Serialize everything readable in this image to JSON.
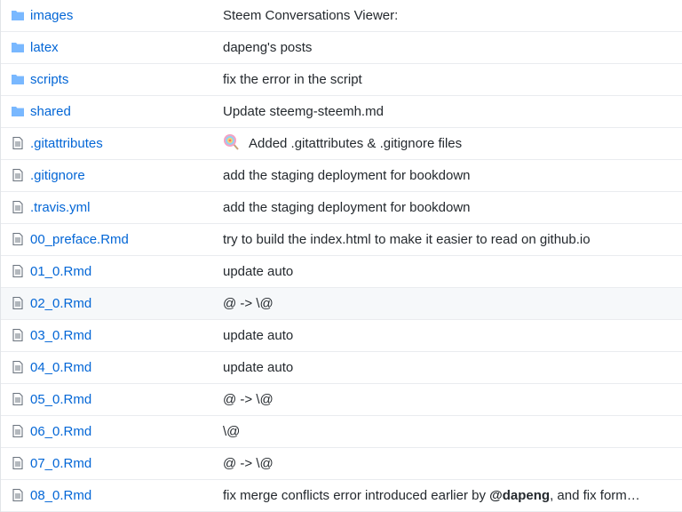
{
  "files": [
    {
      "name": "images",
      "type": "folder",
      "message": "Steem Conversations Viewer:"
    },
    {
      "name": "latex",
      "type": "folder",
      "message": "dapeng's posts"
    },
    {
      "name": "scripts",
      "type": "folder",
      "message": "fix the error in the script"
    },
    {
      "name": "shared",
      "type": "folder",
      "message": "Update steemg-steemh.md"
    },
    {
      "name": ".gitattributes",
      "type": "file",
      "message": "Added .gitattributes & .gitignore files",
      "message_icon": "lollipop-icon"
    },
    {
      "name": ".gitignore",
      "type": "file",
      "message": "add the staging deployment for bookdown"
    },
    {
      "name": ".travis.yml",
      "type": "file",
      "message": "add the staging deployment for bookdown"
    },
    {
      "name": "00_preface.Rmd",
      "type": "file",
      "message": "try to build the index.html to make it easier to read on github.io"
    },
    {
      "name": "01_0.Rmd",
      "type": "file",
      "message": "update auto"
    },
    {
      "name": "02_0.Rmd",
      "type": "file",
      "message": "@ -> \\@",
      "highlighted": true
    },
    {
      "name": "03_0.Rmd",
      "type": "file",
      "message": "update auto"
    },
    {
      "name": "04_0.Rmd",
      "type": "file",
      "message": "update auto"
    },
    {
      "name": "05_0.Rmd",
      "type": "file",
      "message": "@ -> \\@"
    },
    {
      "name": "06_0.Rmd",
      "type": "file",
      "message": "\\@"
    },
    {
      "name": "07_0.Rmd",
      "type": "file",
      "message": "@ -> \\@"
    },
    {
      "name": "08_0.Rmd",
      "type": "file",
      "message_parts": [
        "fix merge conflicts error introduced earlier by ",
        "@dapeng",
        ", and fix form…"
      ]
    }
  ],
  "colors": {
    "link": "#0366d6",
    "folder_icon": "#79b8ff",
    "file_icon": "#6a737d",
    "text": "#24292e",
    "row_border": "#eaecef",
    "row_highlight": "#f6f8fa"
  }
}
